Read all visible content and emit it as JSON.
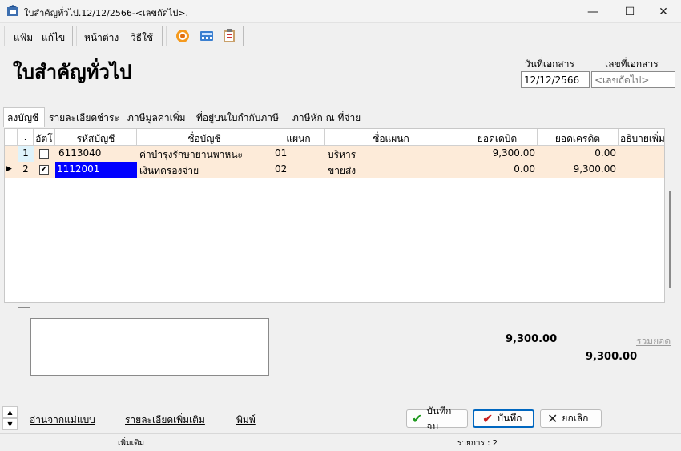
{
  "window": {
    "title": "ใบสำคัญทั่วไป.12/12/2566-<เลขถัดไป>.",
    "minimize": "—",
    "maximize": "☐",
    "close": "✕"
  },
  "menu": {
    "file": "แฟ้ม",
    "edit": "แก้ไข",
    "window": "หน้าต่าง",
    "help": "วิธีใช้"
  },
  "toolbar": {
    "icons": [
      "target-icon",
      "calculator-icon",
      "clipboard-icon"
    ]
  },
  "header": {
    "title": "ใบสำคัญทั่วไป",
    "date_label": "วันที่เอกสาร",
    "docno_label": "เลขที่เอกสาร",
    "date_value": "12/12/2566",
    "docno_placeholder": "<เลขถัดไป>"
  },
  "tabs": [
    "ลงบัญชี",
    "รายละเอียดชำระ",
    "ภาษีมูลค่าเพิ่ม",
    "ที่อยู่บนใบกำกับภาษี",
    "ภาษีหัก ณ ที่จ่าย"
  ],
  "grid": {
    "columns": [
      ".",
      "อัตโ",
      "รหัสบัญชี",
      "ชื่อบัญชี",
      "แผนก",
      "ชื่อแผนก",
      "ยอดเดบิต",
      "ยอดเครดิต",
      "อธิบายเพิ่ม"
    ],
    "rows": [
      {
        "no": "1",
        "auto": false,
        "account_code": "6113040",
        "account_name": "ค่าบำรุงรักษายานพาหนะ",
        "dept": "01",
        "dept_name": "บริหาร",
        "debit": "9,300.00",
        "credit": "0.00",
        "current": false
      },
      {
        "no": "2",
        "auto": true,
        "account_code": "1112001",
        "account_name": "เงินทดรองจ่าย",
        "dept": "02",
        "dept_name": "ขายส่ง",
        "debit": "0.00",
        "credit": "9,300.00",
        "current": true
      }
    ]
  },
  "totals": {
    "debit_total": "9,300.00",
    "credit_total": "9,300.00",
    "sum_link": "รวมยอด"
  },
  "footer": {
    "read_template": "อ่านจากแม่แบบ",
    "more_details": "รายละเอียดเพิ่มเติม",
    "print": "พิมพ์",
    "save_close": "บันทึกจบ",
    "save": "บันทึก",
    "cancel": "ยกเลิก"
  },
  "status": {
    "mode": "เพิ่มเติม",
    "items": "รายการ : 2"
  },
  "colors": {
    "row_bg": "#fdebd9",
    "selected_cell": "#0000ff",
    "default_button_border": "#0067c0"
  }
}
